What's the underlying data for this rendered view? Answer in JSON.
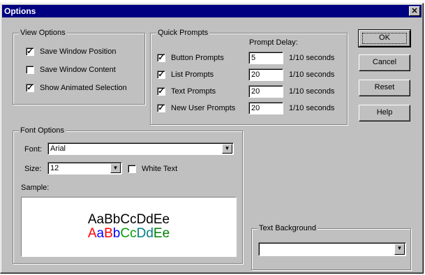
{
  "title": "Options",
  "close_glyph": "✕",
  "view_options": {
    "legend": "View Options",
    "items": [
      {
        "label": "Save Window Position",
        "checked": true
      },
      {
        "label": "Save Window Content",
        "checked": false
      },
      {
        "label": "Show Animated Selection",
        "checked": true
      }
    ]
  },
  "quick_prompts": {
    "legend": "Quick Prompts",
    "delay_header": "Prompt Delay:",
    "unit": "1/10 seconds",
    "items": [
      {
        "label": "Button Prompts",
        "checked": true,
        "delay": "5"
      },
      {
        "label": "List Prompts",
        "checked": true,
        "delay": "20"
      },
      {
        "label": "Text Prompts",
        "checked": true,
        "delay": "20"
      },
      {
        "label": "New User Prompts",
        "checked": true,
        "delay": "20"
      }
    ]
  },
  "buttons": {
    "ok": "OK",
    "cancel": "Cancel",
    "reset": "Reset",
    "help": "Help"
  },
  "font_options": {
    "legend": "Font Options",
    "font_label": "Font:",
    "font_value": "Arial",
    "size_label": "Size:",
    "size_value": "12",
    "white_text_label": "White Text",
    "white_text_checked": false,
    "sample_label": "Sample:",
    "sample_text": "AaBbCcDdEe",
    "sample_colors": [
      "#ff0000",
      "#0000ff",
      "#ff0000",
      "#0000ff",
      "#00a000",
      "#00a000",
      "#008080",
      "#008080",
      "#008000",
      "#008000"
    ]
  },
  "text_background": {
    "legend": "Text Background",
    "value": ""
  },
  "check_glyph": "✓",
  "dropdown_glyph": "▼"
}
